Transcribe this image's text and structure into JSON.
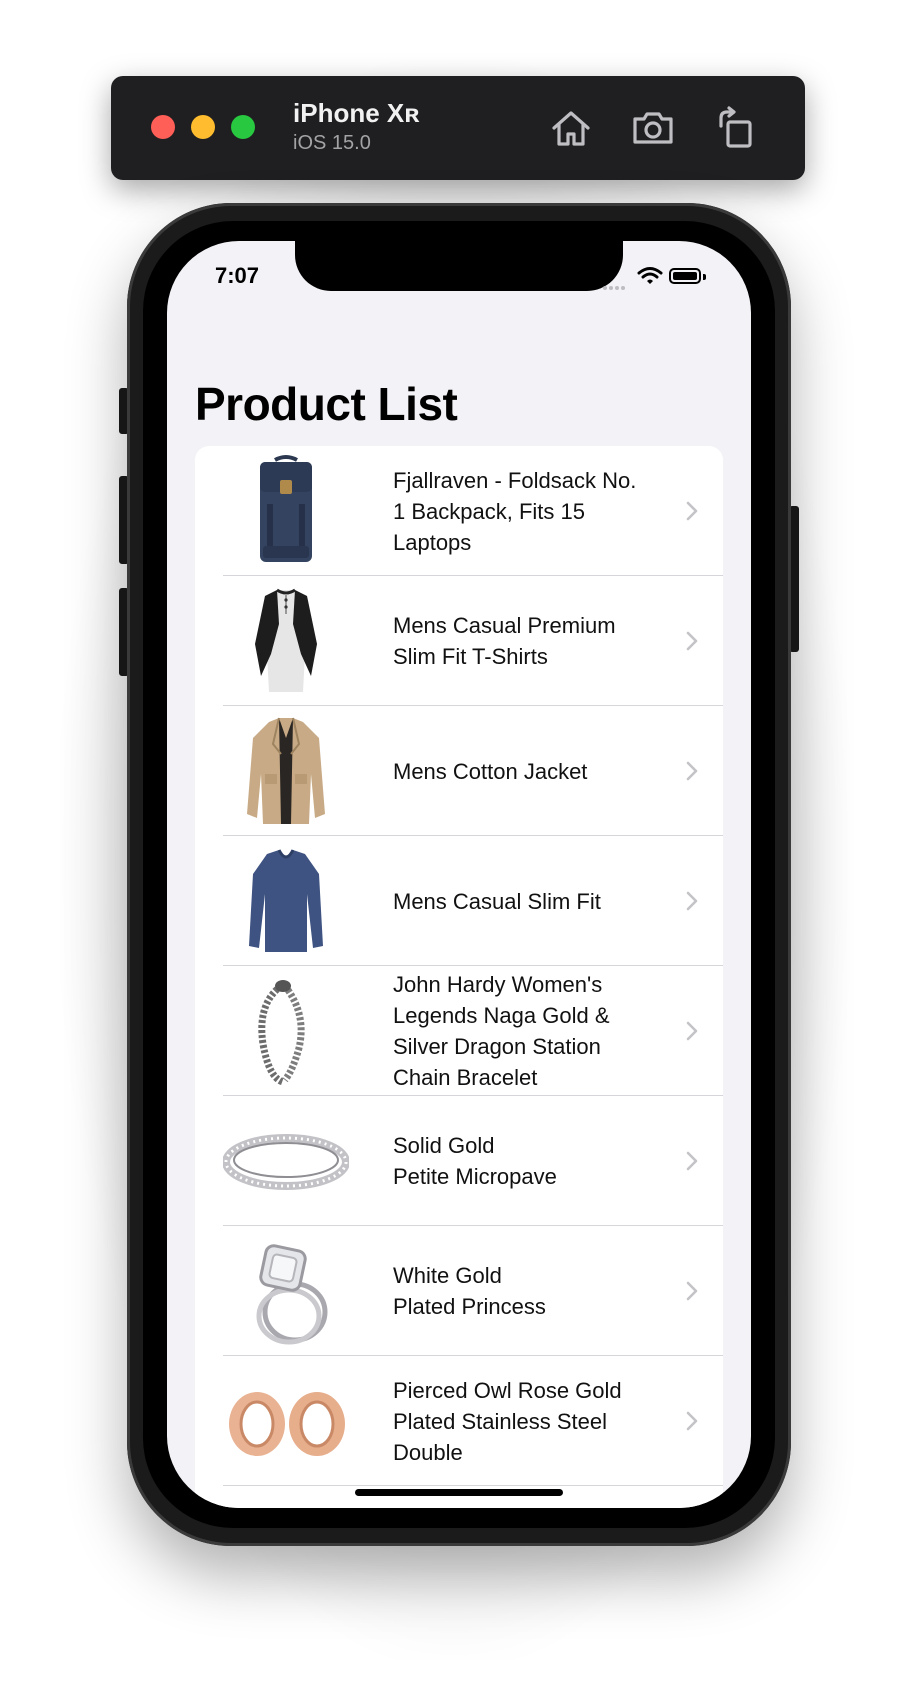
{
  "simulator": {
    "device_name": "iPhone Xʀ",
    "os_version": "iOS 15.0",
    "buttons": [
      "home-icon",
      "screenshot-icon",
      "rotate-icon"
    ]
  },
  "status_bar": {
    "time": "7:07",
    "icons": [
      "cellular-dots-icon",
      "wifi-icon",
      "battery-icon"
    ]
  },
  "screen": {
    "title": "Product List",
    "background": "#f2f2f7"
  },
  "products": [
    {
      "title": "Fjallraven - Foldsack No.\n1 Backpack, Fits 15\nLaptops",
      "image": "backpack"
    },
    {
      "title": "Mens Casual Premium\nSlim Fit T-Shirts",
      "image": "raglan-shirt"
    },
    {
      "title": "Mens Cotton Jacket",
      "image": "jacket"
    },
    {
      "title": "Mens Casual Slim Fit",
      "image": "long-sleeve-shirt"
    },
    {
      "title": "John Hardy Women's\nLegends Naga Gold &\nSilver Dragon Station\nChain Bracelet",
      "image": "dragon-bracelet"
    },
    {
      "title": "Solid Gold\nPetite Micropave",
      "image": "silver-ring"
    },
    {
      "title": "White Gold\nPlated Princess",
      "image": "princess-ring"
    },
    {
      "title": "Pierced Owl Rose Gold\nPlated Stainless Steel\nDouble",
      "image": "rose-gold-plugs"
    }
  ]
}
